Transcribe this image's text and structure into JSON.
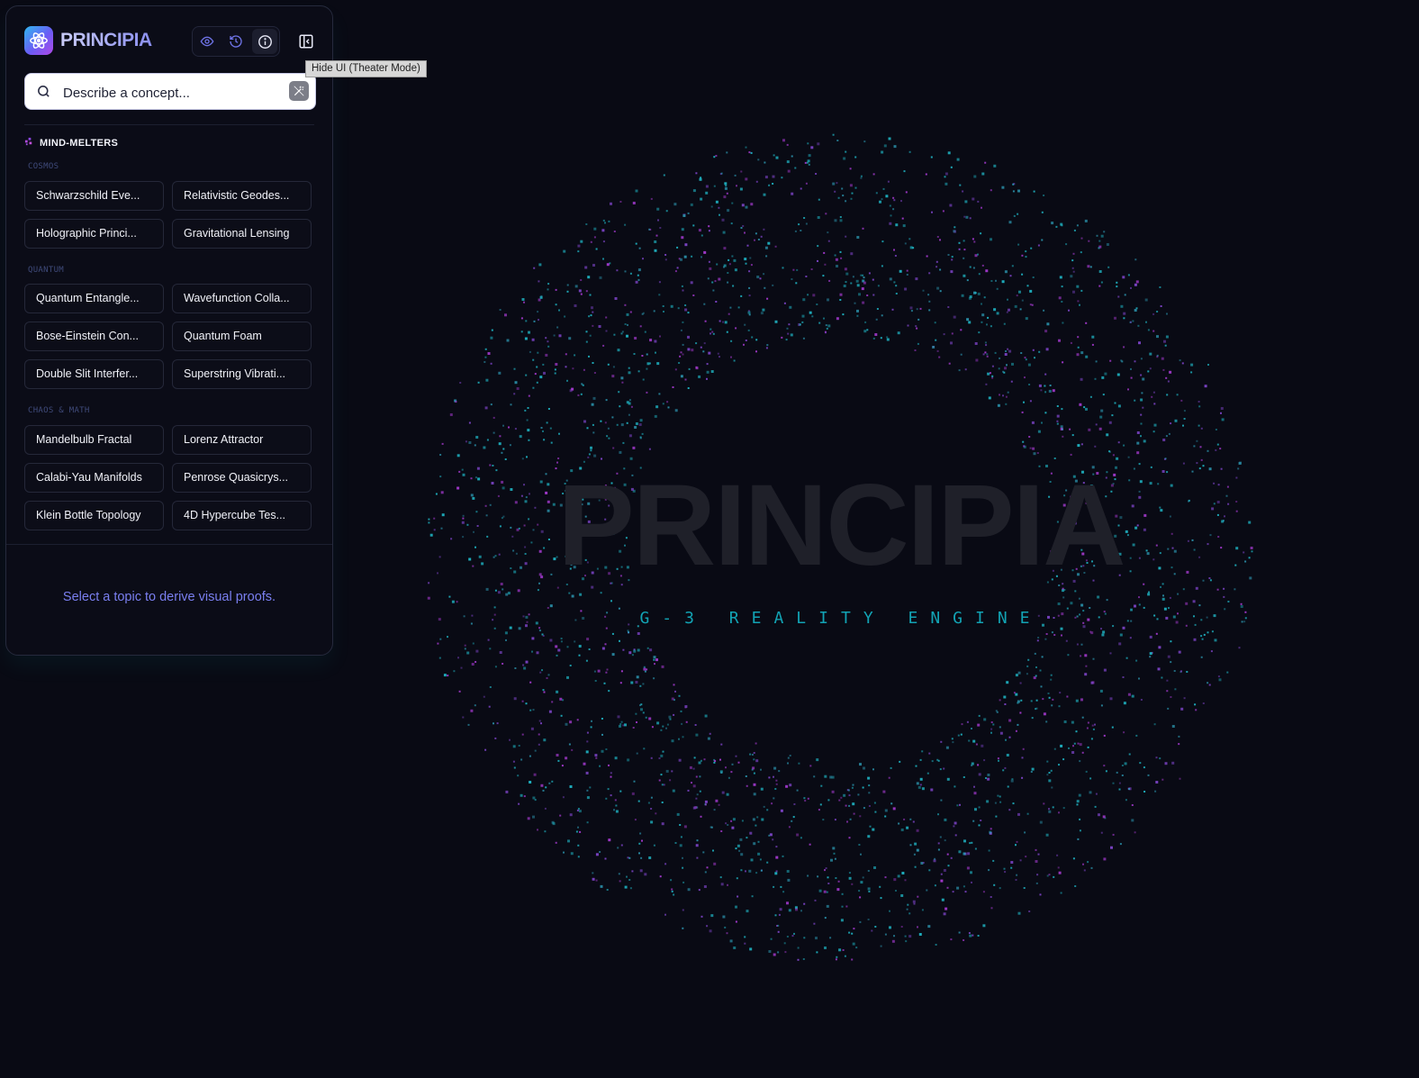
{
  "app": {
    "brand": "PRINCIPIA"
  },
  "toolbar": {
    "icons": [
      "eye-icon",
      "history-icon",
      "info-icon",
      "sidebar-collapse-icon"
    ],
    "tooltip": "Hide UI (Theater Mode)"
  },
  "search": {
    "placeholder": "Describe a concept...",
    "value": ""
  },
  "library": {
    "title": "MIND-MELTERS",
    "categories": [
      {
        "label": "COSMOS",
        "items": [
          "Schwarzschild Eve...",
          "Relativistic Geodes...",
          "Holographic Princi...",
          "Gravitational Lensing"
        ]
      },
      {
        "label": "QUANTUM",
        "items": [
          "Quantum Entangle...",
          "Wavefunction Colla...",
          "Bose-Einstein Con...",
          "Quantum Foam",
          "Double Slit Interfer...",
          "Superstring Vibrati..."
        ]
      },
      {
        "label": "CHAOS & MATH",
        "items": [
          "Mandelbulb Fractal",
          "Lorenz Attractor",
          "Calabi-Yau Manifolds",
          "Penrose Quasicrys...",
          "Klein Bottle Topology",
          "4D Hypercube Tes..."
        ]
      }
    ]
  },
  "status": {
    "hint": "Select a topic to derive visual proofs."
  },
  "hero": {
    "title": "PRINCIPIA",
    "subtitle": "G-3 REALITY ENGINE"
  },
  "colors": {
    "background": "#090a14",
    "accent": "#7a7ff0",
    "particle_cyan": "#1fb3c2",
    "particle_magenta": "#a53ad0"
  }
}
